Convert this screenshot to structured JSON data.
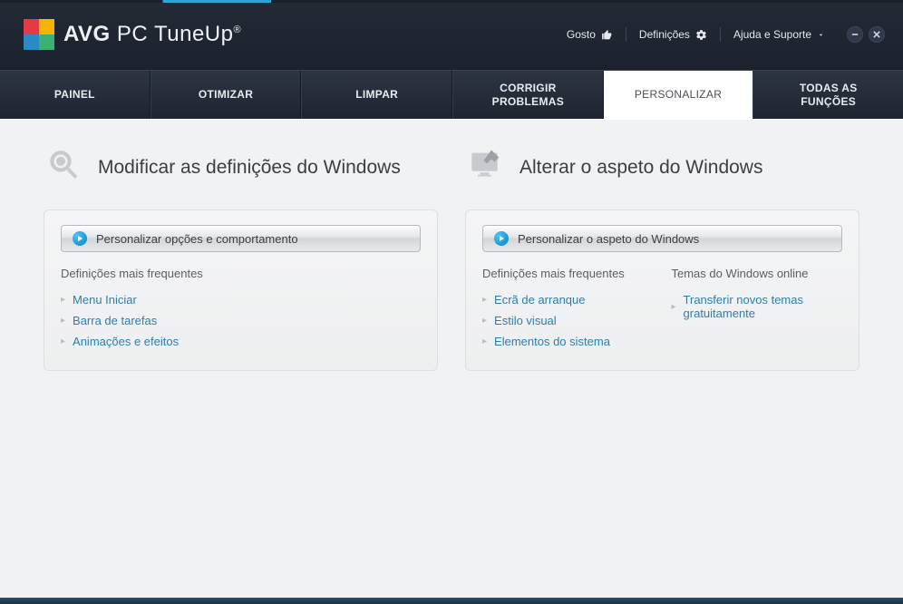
{
  "app": {
    "logo_brand": "AVG",
    "logo_product": "PC TuneUp",
    "registered": "®"
  },
  "titlebar": {
    "like": "Gosto",
    "settings": "Definições",
    "help": "Ajuda e Suporte"
  },
  "nav": {
    "items": [
      {
        "label": "PAINEL"
      },
      {
        "label": "OTIMIZAR"
      },
      {
        "label": "LIMPAR"
      },
      {
        "label": "CORRIGIR PROBLEMAS"
      },
      {
        "label": "PERSONALIZAR",
        "active": true
      },
      {
        "label": "TODAS AS FUNÇÕES"
      }
    ]
  },
  "left": {
    "title": "Modificar as definições do Windows",
    "panel_btn": "Personalizar opções e comportamento",
    "sub_head": "Definições mais frequentes",
    "links": [
      "Menu Iniciar",
      "Barra de tarefas",
      "Animações e efeitos"
    ]
  },
  "right": {
    "title": "Alterar o aspeto do Windows",
    "panel_btn": "Personalizar o aspeto do Windows",
    "sub_head_a": "Definições mais frequentes",
    "sub_head_b": "Temas do Windows online",
    "links_a": [
      "Ecrã de arranque",
      "Estilo visual",
      "Elementos do sistema"
    ],
    "links_b": [
      "Transferir novos temas gratuitamente"
    ]
  }
}
